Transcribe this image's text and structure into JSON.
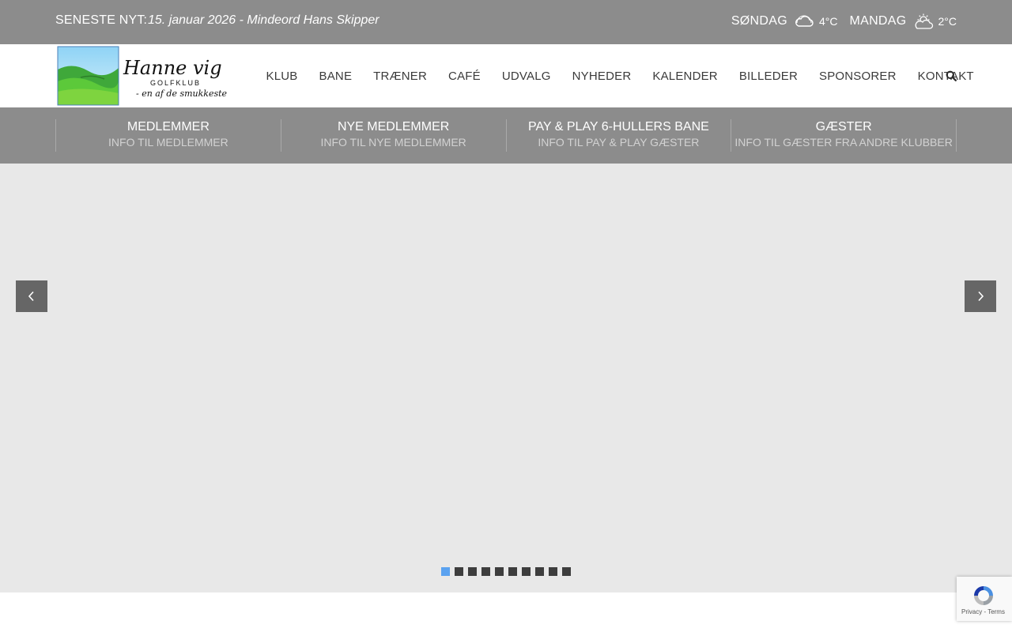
{
  "topbar": {
    "news_label": "SENESTE NYT:",
    "news_text": "15. januar 2026 - Mindeord Hans Skipper",
    "weather": [
      {
        "day": "SØNDAG",
        "icon": "cloud-icon",
        "temp": "4°C"
      },
      {
        "day": "MANDAG",
        "icon": "partly-cloudy-icon",
        "temp": "2°C"
      }
    ]
  },
  "logo": {
    "text_main": "Hanne vig",
    "text_sub": "GOLFKLUB",
    "tagline": "- en af de smukkeste"
  },
  "nav": {
    "items": [
      "KLUB",
      "BANE",
      "TRÆNER",
      "CAFÉ",
      "UDVALG",
      "NYHEDER",
      "KALENDER",
      "BILLEDER",
      "SPONSORER",
      "KONTAKT"
    ],
    "search_icon": "search-icon"
  },
  "quicklinks": [
    {
      "title": "MEDLEMMER",
      "subtitle": "INFO TIL MEDLEMMER"
    },
    {
      "title": "NYE MEDLEMMER",
      "subtitle": "INFO TIL NYE MEDLEMMER"
    },
    {
      "title": "PAY & PLAY 6-HULLERS BANE",
      "subtitle": "INFO TIL PAY & PLAY GÆSTER"
    },
    {
      "title": "GÆSTER",
      "subtitle": "INFO TIL GÆSTER FRA ANDRE KLUBBER"
    }
  ],
  "slider": {
    "slide_count": 10,
    "active_slide": 1,
    "prev_icon": "chevron-left-icon",
    "next_icon": "chevron-right-icon"
  },
  "recaptcha": {
    "text": "Privacy - Terms"
  },
  "colors": {
    "topbar_bg": "#8c8c8c",
    "slider_bg": "#e8e8e8",
    "active_dot": "#5aa2f0"
  }
}
